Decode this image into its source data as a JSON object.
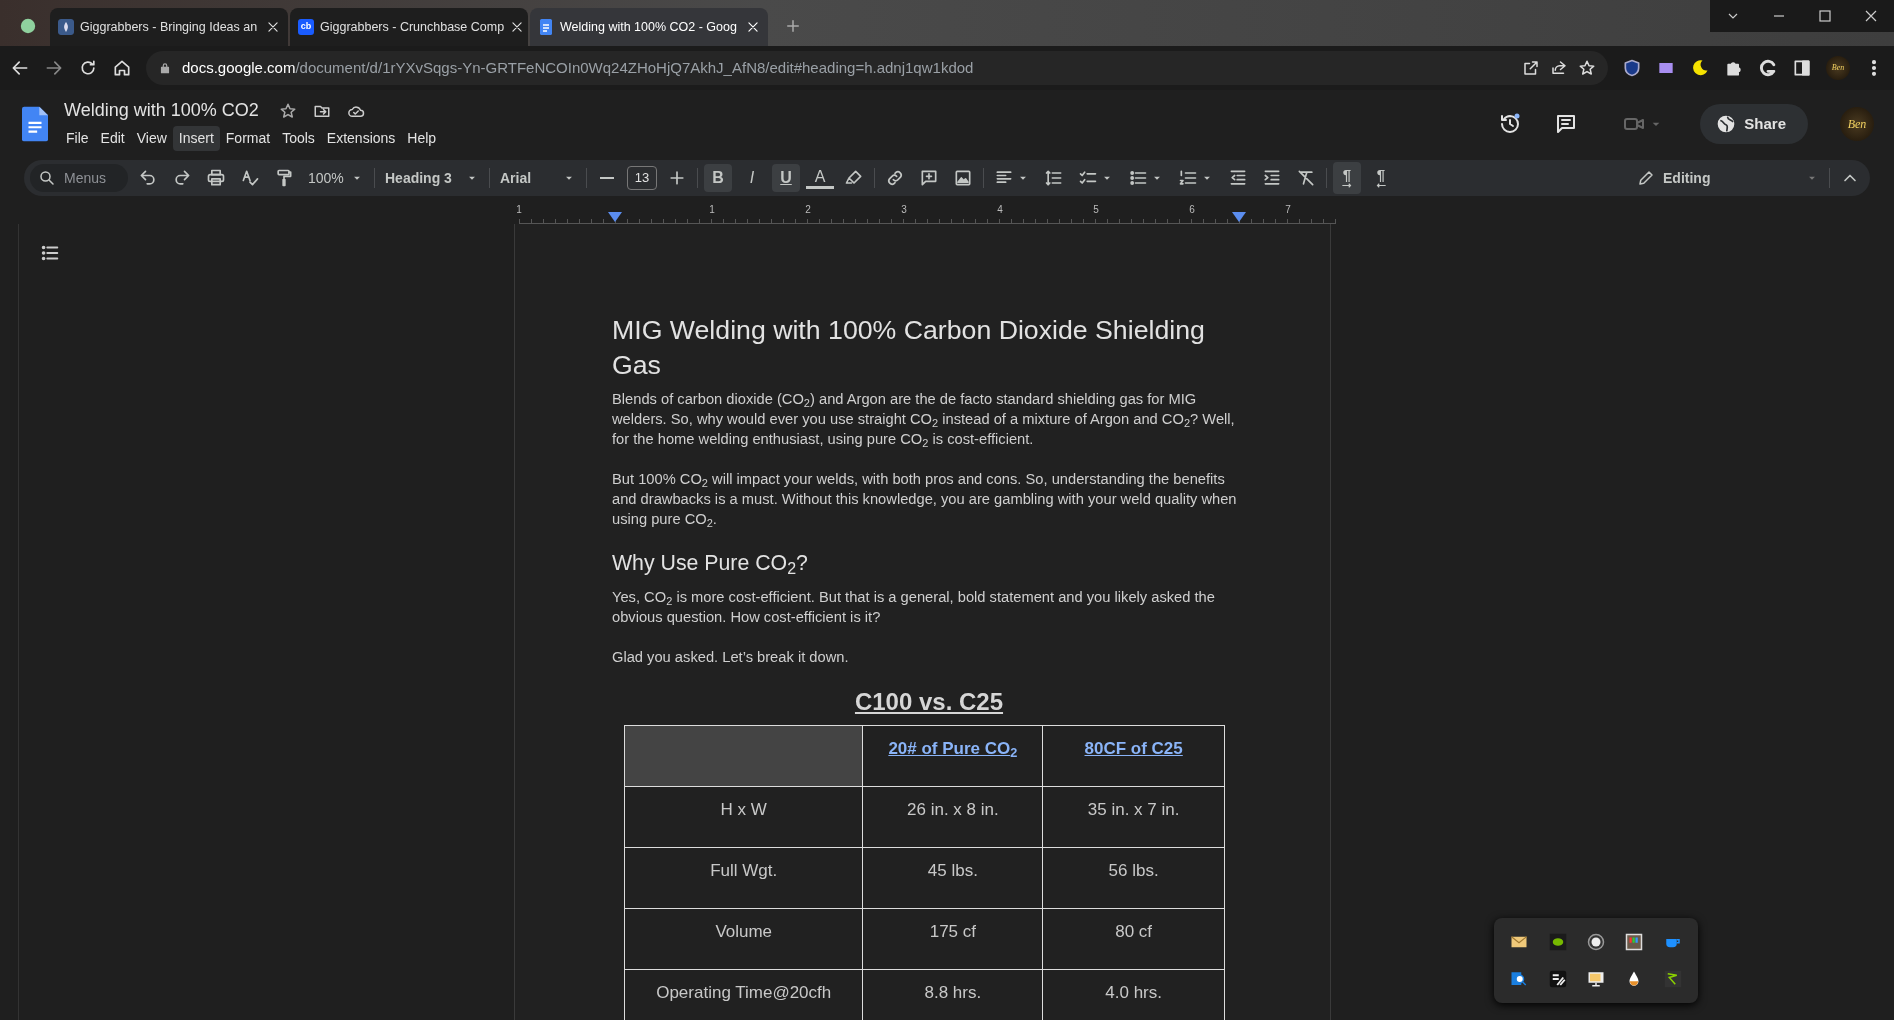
{
  "browser": {
    "tabs": [
      {
        "title": "Giggrabbers - Bringing Ideas an",
        "kind": "logo",
        "selected": false
      },
      {
        "title": "Giggrabbers - Crunchbase Comp",
        "kind": "monogram",
        "icon_text": "cb",
        "selected": false
      },
      {
        "title": "Welding with 100% CO2 - Goog",
        "kind": "docs",
        "selected": true
      }
    ],
    "address": {
      "domain": "docs.google.com",
      "path": "/document/d/1rYXvSqgs-Yn-GRTFeNCOIn0Wq24ZHoHjQ7AkhJ_AfN8/edit#heading=h.adnj1qw1kdod"
    },
    "profile_text": "Ben"
  },
  "docs": {
    "title": "Welding with 100% CO2",
    "menus": [
      {
        "label": "File",
        "highlighted": false
      },
      {
        "label": "Edit",
        "highlighted": false
      },
      {
        "label": "View",
        "highlighted": false
      },
      {
        "label": "Insert",
        "highlighted": true
      },
      {
        "label": "Format",
        "highlighted": false
      },
      {
        "label": "Tools",
        "highlighted": false
      },
      {
        "label": "Extensions",
        "highlighted": false
      },
      {
        "label": "Help",
        "highlighted": false
      }
    ],
    "share": "Share",
    "avatar_text": "Ben"
  },
  "toolbar": {
    "search_placeholder": "Menus",
    "zoom": "100%",
    "style": "Heading 3",
    "font": "Arial",
    "font_size": "13",
    "format_buttons": [
      {
        "label": "B",
        "kind": "bold",
        "active": true
      },
      {
        "label": "I",
        "kind": "italic",
        "active": false
      },
      {
        "label": "U",
        "kind": "underline",
        "active": true
      },
      {
        "label": "A",
        "kind": "color",
        "active": false
      }
    ],
    "direction_buttons": [
      {
        "label": "¶",
        "kind": "ltr",
        "active": true
      },
      {
        "label": "¶",
        "kind": "rtl",
        "active": false
      }
    ],
    "mode": "Editing"
  },
  "ruler": [
    "1",
    "1",
    "2",
    "3",
    "4",
    "5",
    "6",
    "7"
  ],
  "document": {
    "heading": "MIG Welding with 100% Carbon Dioxide Shielding Gas",
    "blocks": [
      {
        "kind": "paragraph",
        "text": "Blends of carbon dioxide (CO$_{2}$) and Argon are the de facto standard shielding gas for MIG welders. So, why would ever you use straight CO$_{2}$ instead of a mixture of Argon and CO$_{2}$? Well, for the home welding enthusiast, using pure CO$_{2}$ is cost-efficient."
      },
      {
        "kind": "paragraph",
        "text": "But 100% CO$_{2}$ will impact your welds, with both pros and cons. So, understanding the benefits and drawbacks is a must. Without this knowledge, you are gambling with your weld quality when using pure CO$_{2}$."
      },
      {
        "kind": "heading",
        "text": "Why Use Pure CO$_{2}$?"
      },
      {
        "kind": "paragraph",
        "text": "Yes, CO$_{2}$ is more cost-efficient. But that is a general, bold statement and you likely asked the obvious question. How cost-efficient is it?"
      },
      {
        "kind": "paragraph",
        "text": "Glad you asked. Let’s break it down."
      }
    ],
    "table": {
      "title": "C100 vs. C25",
      "columns": [
        "20# of Pure CO$_{2}$",
        "80CF of C25"
      ],
      "rows": [
        {
          "label": "H x W",
          "values": [
            "26 in. x 8 in.",
            "35 in. x 7 in."
          ]
        },
        {
          "label": "Full Wgt.",
          "values": [
            "45 lbs.",
            "56 lbs."
          ]
        },
        {
          "label": "Volume",
          "values": [
            "175 cf",
            "80 cf"
          ]
        },
        {
          "label": "Operating Time@20cfh",
          "values": [
            "8.8 hrs.",
            "4.0 hrs."
          ]
        }
      ]
    }
  }
}
